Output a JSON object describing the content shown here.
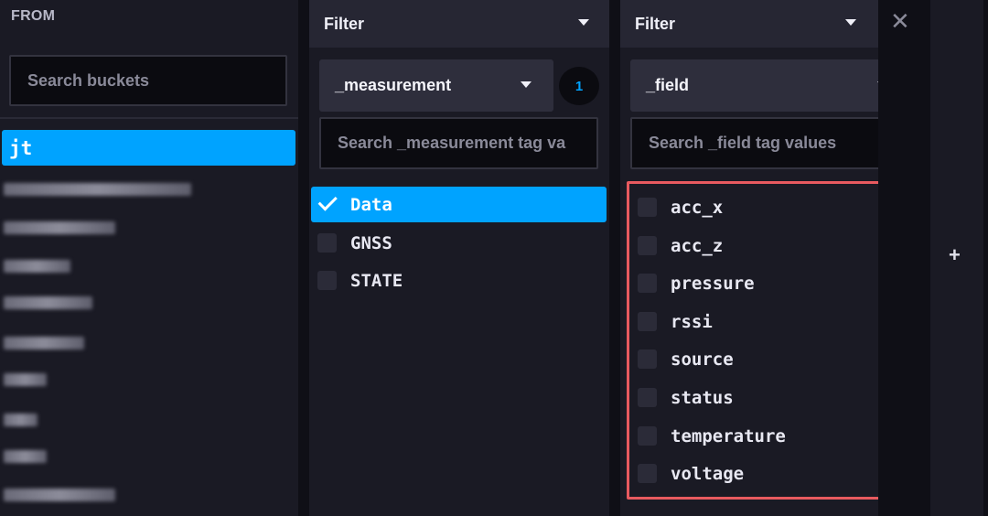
{
  "from": {
    "title": "FROM",
    "search_placeholder": "Search buckets",
    "selected_bucket": "jt"
  },
  "filter1": {
    "header": "Filter",
    "key": "_measurement",
    "count": "1",
    "search_placeholder": "Search _measurement tag va",
    "items": [
      {
        "label": "Data",
        "checked": true
      },
      {
        "label": "GNSS",
        "checked": false
      },
      {
        "label": "STATE",
        "checked": false
      }
    ]
  },
  "filter2": {
    "header": "Filter",
    "key": "_field",
    "search_placeholder": "Search _field tag values",
    "items": [
      {
        "label": "acc_x"
      },
      {
        "label": "acc_z"
      },
      {
        "label": "pressure"
      },
      {
        "label": "rssi"
      },
      {
        "label": "source"
      },
      {
        "label": "status"
      },
      {
        "label": "temperature"
      },
      {
        "label": "voltage"
      }
    ]
  },
  "icons": {
    "close": "close-icon",
    "add": "plus-icon",
    "dropdown": "chevron-down-icon",
    "check": "check-icon"
  },
  "colors": {
    "accent": "#00a3ff",
    "highlight_border": "#e85a5f"
  }
}
